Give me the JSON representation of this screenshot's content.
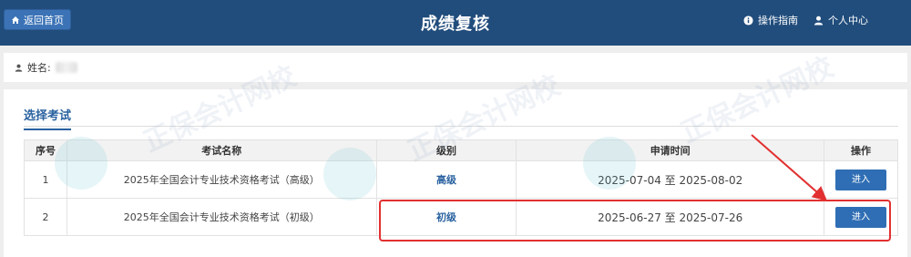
{
  "header": {
    "home_label": "返回首页",
    "title": "成绩复核",
    "guide_label": "操作指南",
    "user_center_label": "个人中心",
    "background_color": "#214d7c"
  },
  "user_info": {
    "name_label": "姓名:"
  },
  "section": {
    "tab_label": "选择考试"
  },
  "table": {
    "headers": [
      "序号",
      "考试名称",
      "级别",
      "申请时间",
      "操作"
    ],
    "rows": [
      {
        "index": "1",
        "exam_name": "2025年全国会计专业技术资格考试（高级）",
        "level": "高级",
        "apply_time": "2025-07-04 至 2025-08-02",
        "action": "进入"
      },
      {
        "index": "2",
        "exam_name": "2025年全国会计专业技术资格考试（初级）",
        "level": "初级",
        "apply_time": "2025-06-27 至 2025-07-26",
        "action": "进入"
      }
    ]
  },
  "watermark": {
    "text": "正保会计网校"
  },
  "annotation": {
    "color": "#e23030"
  }
}
